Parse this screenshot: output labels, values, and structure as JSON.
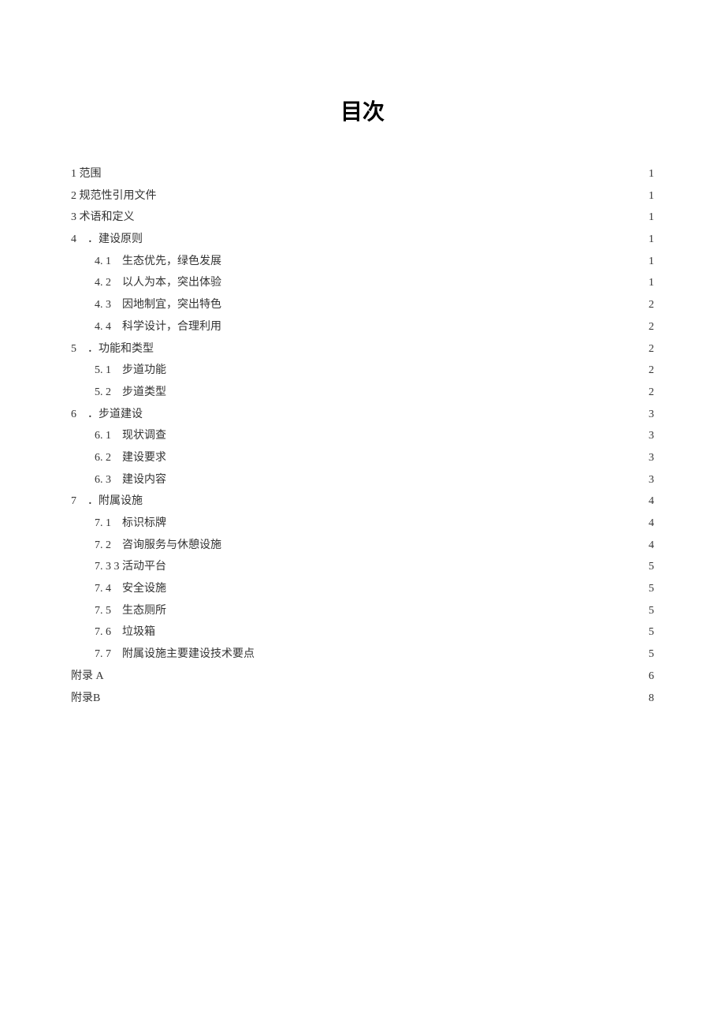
{
  "title": "目次",
  "toc": [
    {
      "label": "1 范围",
      "page": "1",
      "indent": 0
    },
    {
      "label": "2 规范性引用文件",
      "page": "1",
      "indent": 0
    },
    {
      "label": "3 术语和定义",
      "page": "1",
      "indent": 0
    },
    {
      "label": "4　．建设原则 ",
      "page": " 1",
      "indent": "0b"
    },
    {
      "label": "4. 1　生态优先，绿色发展",
      "page": "1",
      "indent": 1
    },
    {
      "label": "4. 2　以人为本，突出体验",
      "page": "1",
      "indent": 1
    },
    {
      "label": "4. 3　因地制宜，突出特色",
      "page": "2",
      "indent": 1
    },
    {
      "label": "4. 4　科学设计，合理利用",
      "page": "2",
      "indent": 1
    },
    {
      "label": "5　．功能和类型 ",
      "page": " 2",
      "indent": "0b"
    },
    {
      "label": "5. 1　步道功能 ",
      "page": " 2",
      "indent": 1
    },
    {
      "label": "5. 2　步道类型 ",
      "page": " 2",
      "indent": 1
    },
    {
      "label": "6　．步道建设 ",
      "page": " 3",
      "indent": "0b"
    },
    {
      "label": "6. 1　现状调查 ",
      "page": " 3",
      "indent": 1
    },
    {
      "label": "6. 2　建设要求 ",
      "page": " 3",
      "indent": 1
    },
    {
      "label": "6. 3　建设内容 ",
      "page": " 3",
      "indent": 1
    },
    {
      "label": "7　．附属设施 ",
      "page": " 4",
      "indent": "0b"
    },
    {
      "label": "7. 1　标识标牌 ",
      "page": " 4",
      "indent": 1
    },
    {
      "label": "7. 2　咨询服务与休憩设施 ",
      "page": " 4",
      "indent": 1
    },
    {
      "label": "7. 3 3 活动平台",
      "page": "5",
      "indent": 1
    },
    {
      "label": "7. 4　安全设施 ",
      "page": " 5",
      "indent": 1
    },
    {
      "label": "7. 5　生态厕所 ",
      "page": " 5",
      "indent": 1
    },
    {
      "label": "7. 6　垃圾箱 ",
      "page": " 5",
      "indent": 1
    },
    {
      "label": "7. 7　附属设施主要建设技术要点",
      "page": "5",
      "indent": 1
    },
    {
      "label": "附录 A ",
      "page": " 6",
      "indent": 0
    },
    {
      "label": "附录B ",
      "page": " 8",
      "indent": 0
    }
  ]
}
